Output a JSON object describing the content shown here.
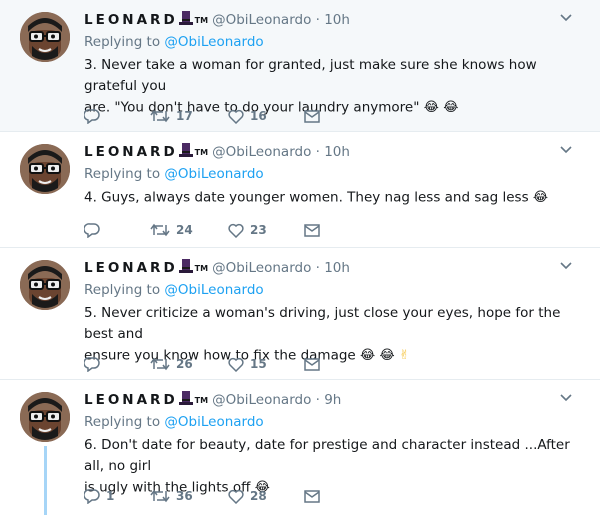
{
  "tweets": [
    {
      "name": "LEONARD",
      "tm": "TM",
      "handle_time": "@ObiLeonardo · 10h",
      "reply_prefix": "Replying to ",
      "reply_handle": "@ObiLeonardo",
      "text_line1": "3. Never take a woman for granted, just make sure she knows how grateful you",
      "text_line2": "are. \"You don't have to do your laundry anymore\"",
      "emojis": [
        "😂",
        "😂"
      ],
      "reply_count": "",
      "retweet_count": "17",
      "like_count": "16"
    },
    {
      "name": "LEONARD",
      "tm": "TM",
      "handle_time": "@ObiLeonardo · 10h",
      "reply_prefix": "Replying to ",
      "reply_handle": "@ObiLeonardo",
      "text_line1": "4. Guys, always date younger women. They nag less and sag less",
      "text_line2": "",
      "emojis": [
        "😂"
      ],
      "reply_count": "",
      "retweet_count": "24",
      "like_count": "23"
    },
    {
      "name": "LEONARD",
      "tm": "TM",
      "handle_time": "@ObiLeonardo · 10h",
      "reply_prefix": "Replying to ",
      "reply_handle": "@ObiLeonardo",
      "text_line1": "5. Never criticize a woman's driving, just close your eyes, hope for the best and",
      "text_line2": "ensure you know how to fix the damage",
      "emojis": [
        "😂",
        "😂",
        "✌"
      ],
      "reply_count": "",
      "retweet_count": "26",
      "like_count": "15"
    },
    {
      "name": "LEONARD",
      "tm": "TM",
      "handle_time": "@ObiLeonardo · 9h",
      "reply_prefix": "Replying to ",
      "reply_handle": "@ObiLeonardo",
      "text_line1": "6. Don't date for beauty, date for prestige and character instead ...After all, no girl",
      "text_line2": "is ugly with the lights off",
      "emojis": [
        "😂"
      ],
      "reply_count": "1",
      "retweet_count": "36",
      "like_count": "28"
    }
  ],
  "icons": {
    "reply": "reply-icon",
    "retweet": "retweet-icon",
    "like": "heart-icon",
    "dm": "envelope-icon",
    "caret": "chevron-down-icon",
    "hat": "top-hat-icon"
  },
  "colors": {
    "link": "#1da1f2",
    "muted": "#657786",
    "highlight_bg": "#f5f8fa",
    "thread_line": "#a6d5f7"
  }
}
